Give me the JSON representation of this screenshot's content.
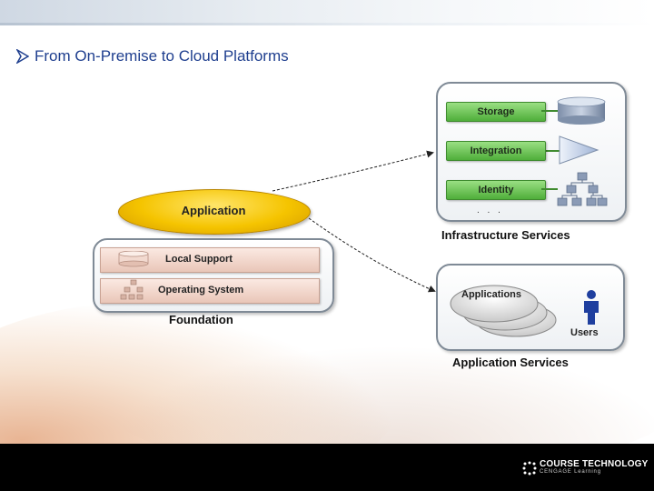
{
  "slide": {
    "title": "From On-Premise to Cloud Platforms",
    "footer_logo_line1": "COURSE TECHNOLOGY",
    "footer_logo_line2": "CENGAGE Learning"
  },
  "diagram": {
    "application": "Application",
    "foundation": {
      "caption": "Foundation",
      "layers": [
        "Local Support",
        "Operating System"
      ]
    },
    "infrastructure": {
      "caption": "Infrastructure Services",
      "items": [
        "Storage",
        "Integration",
        "Identity"
      ],
      "ellipsis": ". . ."
    },
    "app_services": {
      "caption": "Application Services",
      "applications": "Applications",
      "users": "Users"
    }
  },
  "colors": {
    "title": "#1f3f8f",
    "green": "#4fae3a",
    "application_yellow": "#f5c400",
    "users_blue": "#1f3f9f"
  }
}
